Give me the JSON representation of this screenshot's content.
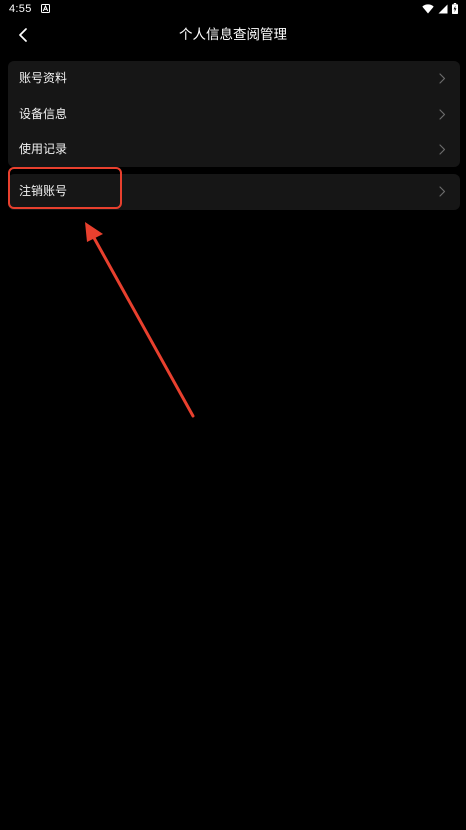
{
  "status_bar": {
    "time": "4:55",
    "notification_icon": "a-square-icon",
    "icons": [
      "wifi-icon",
      "cellular-signal-icon",
      "battery-charging-icon"
    ]
  },
  "header": {
    "back_icon": "chevron-left-icon",
    "title": "个人信息查阅管理"
  },
  "menu": {
    "group1": [
      {
        "label": "账号资料"
      },
      {
        "label": "设备信息"
      },
      {
        "label": "使用记录"
      }
    ],
    "group2": [
      {
        "label": "注销账号"
      }
    ]
  },
  "annotation": {
    "color": "#e8402e"
  },
  "colors": {
    "background": "#000000",
    "card": "#161616",
    "text": "#f2f2f2",
    "chevron": "#6b6b6b",
    "annotation": "#e8402e"
  }
}
